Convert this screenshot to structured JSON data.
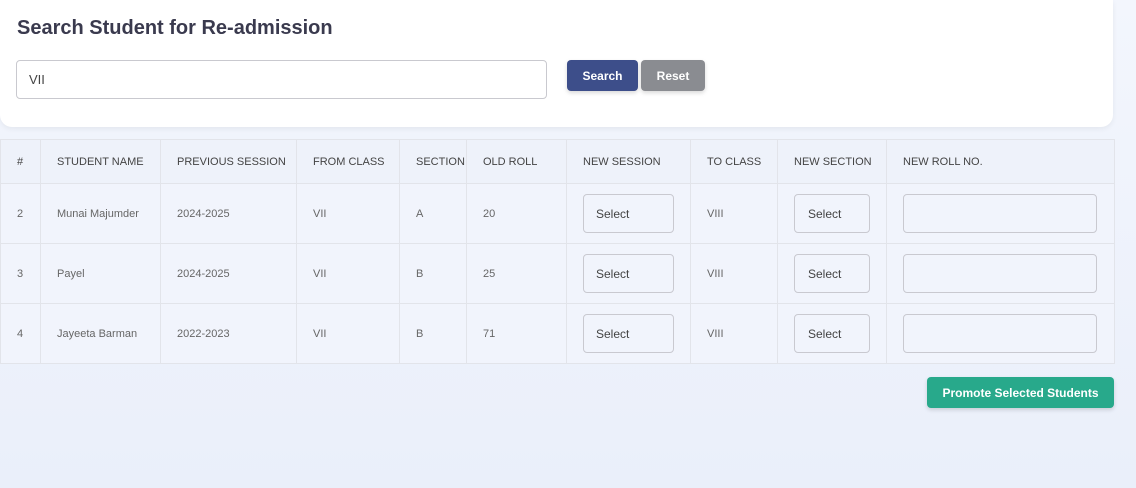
{
  "title": "Search Student for Re-admission",
  "search": {
    "value": "VII",
    "search_label": "Search",
    "reset_label": "Reset"
  },
  "columns": [
    "#",
    "STUDENT NAME",
    "PREVIOUS SESSION",
    "FROM CLASS",
    "SECTION",
    "OLD ROLL",
    "NEW SESSION",
    "TO CLASS",
    "NEW SECTION",
    "NEW ROLL NO."
  ],
  "rows": [
    {
      "num": "2",
      "name": "Munai Majumder",
      "prev_session": "2024-2025",
      "from_class": "VII",
      "section": "A",
      "old_roll": "20",
      "new_session": "Select",
      "to_class": "VIII",
      "new_section": "Select",
      "new_roll": ""
    },
    {
      "num": "3",
      "name": "Payel",
      "prev_session": "2024-2025",
      "from_class": "VII",
      "section": "B",
      "old_roll": "25",
      "new_session": "Select",
      "to_class": "VIII",
      "new_section": "Select",
      "new_roll": ""
    },
    {
      "num": "4",
      "name": "Jayeeta Barman",
      "prev_session": "2022-2023",
      "from_class": "VII",
      "section": "B",
      "old_roll": "71",
      "new_session": "Select",
      "to_class": "VIII",
      "new_section": "Select",
      "new_roll": ""
    }
  ],
  "promote_label": "Promote Selected Students"
}
